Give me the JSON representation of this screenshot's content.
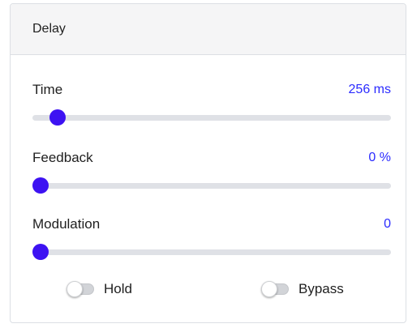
{
  "panel": {
    "title": "Delay"
  },
  "params": [
    {
      "label": "Time",
      "value": "256 ms",
      "level": 0.05
    },
    {
      "label": "Feedback",
      "value": "0 %",
      "level": 0.0
    },
    {
      "label": "Modulation",
      "value": "0",
      "level": 0.0
    }
  ],
  "toggles": [
    {
      "label": "Hold",
      "checked": false
    },
    {
      "label": "Bypass",
      "checked": false
    }
  ],
  "colors": {
    "accent": "#3d12f2",
    "value_text": "#2b2bff",
    "track": "#dfe1e6"
  }
}
